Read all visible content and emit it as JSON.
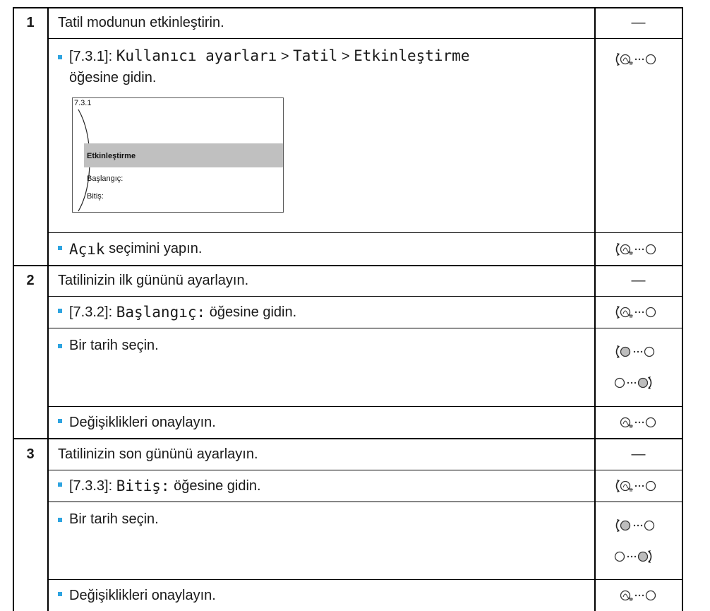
{
  "steps": [
    {
      "number": "1",
      "title": "Tatil modunun etkinleştirin.",
      "title_icon": "—",
      "substeps": [
        {
          "prefix": "[7.3.1]: ",
          "path1": "Kullanıcı ayarları",
          "sep1": " > ",
          "path2": "Tatil",
          "sep2": " > ",
          "path3": "Etkinleştirme",
          "suffix_line2": "öğesine gidin.",
          "icon": "turn-dial-left"
        },
        {
          "code": "Açık",
          "text": " seçimini yapın.",
          "icon": "turn-dial-left"
        }
      ]
    },
    {
      "number": "2",
      "title": "Tatilinizin ilk gününü ayarlayın.",
      "title_icon": "—",
      "substeps": [
        {
          "prefix": "[7.3.2]: ",
          "code": "Başlangıç:",
          "text": " öğesine gidin.",
          "icon": "turn-dial-left"
        },
        {
          "text": "Bir tarih seçin.",
          "icons": [
            "turn-dial-left-filled",
            "turn-dial-right-filled"
          ]
        },
        {
          "text": "Değişiklikleri onaylayın.",
          "icon": "press-dial-left"
        }
      ]
    },
    {
      "number": "3",
      "title": "Tatilinizin son gününü ayarlayın.",
      "title_icon": "—",
      "substeps": [
        {
          "prefix": "[7.3.3]: ",
          "code": "Bitiş:",
          "text": " öğesine gidin.",
          "icon": "turn-dial-left"
        },
        {
          "text": "Bir tarih seçin.",
          "icons": [
            "turn-dial-left-filled",
            "turn-dial-right-filled"
          ]
        },
        {
          "text": "Değişiklikleri onaylayın.",
          "icon": "press-dial-left"
        }
      ]
    }
  ],
  "screen": {
    "code": "7.3.1",
    "selected": "Etkinleştirme",
    "items": [
      "Başlangıç:",
      "Bitiş:"
    ]
  }
}
